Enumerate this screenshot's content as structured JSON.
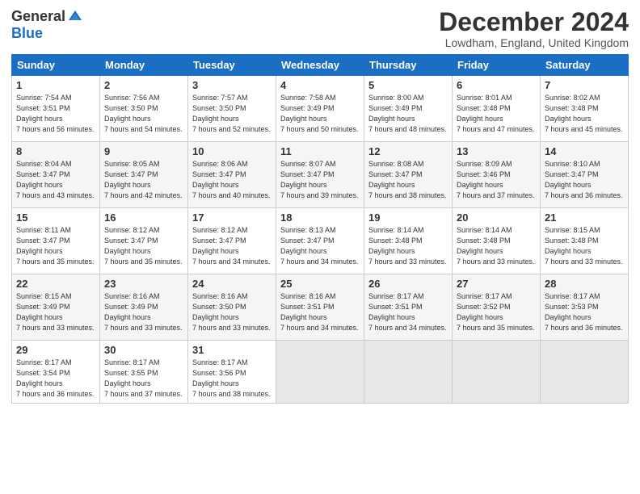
{
  "header": {
    "logo_general": "General",
    "logo_blue": "Blue",
    "title": "December 2024",
    "location": "Lowdham, England, United Kingdom"
  },
  "days_of_week": [
    "Sunday",
    "Monday",
    "Tuesday",
    "Wednesday",
    "Thursday",
    "Friday",
    "Saturday"
  ],
  "weeks": [
    [
      {
        "day": "1",
        "sunrise": "7:54 AM",
        "sunset": "3:51 PM",
        "daylight": "7 hours and 56 minutes."
      },
      {
        "day": "2",
        "sunrise": "7:56 AM",
        "sunset": "3:50 PM",
        "daylight": "7 hours and 54 minutes."
      },
      {
        "day": "3",
        "sunrise": "7:57 AM",
        "sunset": "3:50 PM",
        "daylight": "7 hours and 52 minutes."
      },
      {
        "day": "4",
        "sunrise": "7:58 AM",
        "sunset": "3:49 PM",
        "daylight": "7 hours and 50 minutes."
      },
      {
        "day": "5",
        "sunrise": "8:00 AM",
        "sunset": "3:49 PM",
        "daylight": "7 hours and 48 minutes."
      },
      {
        "day": "6",
        "sunrise": "8:01 AM",
        "sunset": "3:48 PM",
        "daylight": "7 hours and 47 minutes."
      },
      {
        "day": "7",
        "sunrise": "8:02 AM",
        "sunset": "3:48 PM",
        "daylight": "7 hours and 45 minutes."
      }
    ],
    [
      {
        "day": "8",
        "sunrise": "8:04 AM",
        "sunset": "3:47 PM",
        "daylight": "7 hours and 43 minutes."
      },
      {
        "day": "9",
        "sunrise": "8:05 AM",
        "sunset": "3:47 PM",
        "daylight": "7 hours and 42 minutes."
      },
      {
        "day": "10",
        "sunrise": "8:06 AM",
        "sunset": "3:47 PM",
        "daylight": "7 hours and 40 minutes."
      },
      {
        "day": "11",
        "sunrise": "8:07 AM",
        "sunset": "3:47 PM",
        "daylight": "7 hours and 39 minutes."
      },
      {
        "day": "12",
        "sunrise": "8:08 AM",
        "sunset": "3:47 PM",
        "daylight": "7 hours and 38 minutes."
      },
      {
        "day": "13",
        "sunrise": "8:09 AM",
        "sunset": "3:46 PM",
        "daylight": "7 hours and 37 minutes."
      },
      {
        "day": "14",
        "sunrise": "8:10 AM",
        "sunset": "3:47 PM",
        "daylight": "7 hours and 36 minutes."
      }
    ],
    [
      {
        "day": "15",
        "sunrise": "8:11 AM",
        "sunset": "3:47 PM",
        "daylight": "7 hours and 35 minutes."
      },
      {
        "day": "16",
        "sunrise": "8:12 AM",
        "sunset": "3:47 PM",
        "daylight": "7 hours and 35 minutes."
      },
      {
        "day": "17",
        "sunrise": "8:12 AM",
        "sunset": "3:47 PM",
        "daylight": "7 hours and 34 minutes."
      },
      {
        "day": "18",
        "sunrise": "8:13 AM",
        "sunset": "3:47 PM",
        "daylight": "7 hours and 34 minutes."
      },
      {
        "day": "19",
        "sunrise": "8:14 AM",
        "sunset": "3:48 PM",
        "daylight": "7 hours and 33 minutes."
      },
      {
        "day": "20",
        "sunrise": "8:14 AM",
        "sunset": "3:48 PM",
        "daylight": "7 hours and 33 minutes."
      },
      {
        "day": "21",
        "sunrise": "8:15 AM",
        "sunset": "3:48 PM",
        "daylight": "7 hours and 33 minutes."
      }
    ],
    [
      {
        "day": "22",
        "sunrise": "8:15 AM",
        "sunset": "3:49 PM",
        "daylight": "7 hours and 33 minutes."
      },
      {
        "day": "23",
        "sunrise": "8:16 AM",
        "sunset": "3:49 PM",
        "daylight": "7 hours and 33 minutes."
      },
      {
        "day": "24",
        "sunrise": "8:16 AM",
        "sunset": "3:50 PM",
        "daylight": "7 hours and 33 minutes."
      },
      {
        "day": "25",
        "sunrise": "8:16 AM",
        "sunset": "3:51 PM",
        "daylight": "7 hours and 34 minutes."
      },
      {
        "day": "26",
        "sunrise": "8:17 AM",
        "sunset": "3:51 PM",
        "daylight": "7 hours and 34 minutes."
      },
      {
        "day": "27",
        "sunrise": "8:17 AM",
        "sunset": "3:52 PM",
        "daylight": "7 hours and 35 minutes."
      },
      {
        "day": "28",
        "sunrise": "8:17 AM",
        "sunset": "3:53 PM",
        "daylight": "7 hours and 36 minutes."
      }
    ],
    [
      {
        "day": "29",
        "sunrise": "8:17 AM",
        "sunset": "3:54 PM",
        "daylight": "7 hours and 36 minutes."
      },
      {
        "day": "30",
        "sunrise": "8:17 AM",
        "sunset": "3:55 PM",
        "daylight": "7 hours and 37 minutes."
      },
      {
        "day": "31",
        "sunrise": "8:17 AM",
        "sunset": "3:56 PM",
        "daylight": "7 hours and 38 minutes."
      },
      null,
      null,
      null,
      null
    ]
  ]
}
